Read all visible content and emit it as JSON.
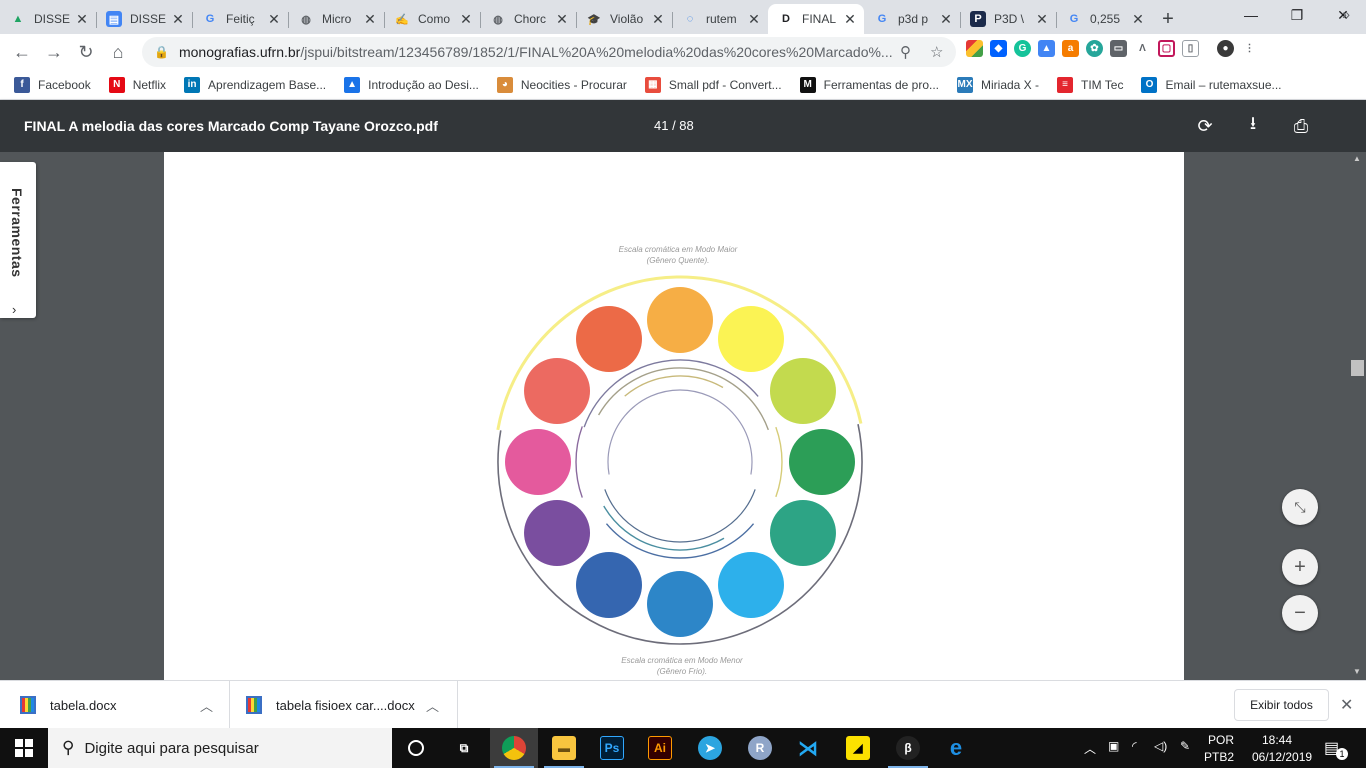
{
  "tabs": [
    {
      "title": "DISSE",
      "icon": "google-drive-icon",
      "color": "#1fa463",
      "active": false
    },
    {
      "title": "DISSE",
      "icon": "google-docs-icon",
      "color": "#4285f4",
      "active": false
    },
    {
      "title": "Feitiç",
      "icon": "google-icon",
      "color": "#4285f4",
      "active": false
    },
    {
      "title": "Micro",
      "icon": "globe-icon",
      "color": "#5f6368",
      "active": false
    },
    {
      "title": "Como",
      "icon": "pen-icon",
      "color": "#c0392b",
      "active": false
    },
    {
      "title": "Chorc",
      "icon": "globe-icon",
      "color": "#5f6368",
      "active": false
    },
    {
      "title": "Violão",
      "icon": "graduation-icon",
      "color": "#e6a817",
      "active": false
    },
    {
      "title": "rutem",
      "icon": "loading-icon",
      "color": "#1a73e8",
      "active": false
    },
    {
      "title": "FINAL",
      "icon": "d-icon",
      "color": "#202124",
      "active": true
    },
    {
      "title": "p3d p",
      "icon": "google-icon",
      "color": "#4285f4",
      "active": false
    },
    {
      "title": "P3D \\",
      "icon": "p-icon",
      "color": "#1b2a4a",
      "active": false
    },
    {
      "title": "0,255",
      "icon": "google-icon",
      "color": "#4285f4",
      "active": false
    }
  ],
  "address": {
    "host": "monografias.ufrn.br",
    "path": "/jspui/bitstream/123456789/1852/1/FINAL%20A%20melodia%20das%20cores%20Marcado%..."
  },
  "bookmarks": [
    {
      "label": "Facebook",
      "icon": "facebook-icon",
      "color": "#3b5998",
      "glyph": "f"
    },
    {
      "label": "Netflix",
      "icon": "netflix-icon",
      "color": "#e50914",
      "glyph": "N"
    },
    {
      "label": "Aprendizagem Base...",
      "icon": "linkedin-icon",
      "color": "#0077b5",
      "glyph": "in"
    },
    {
      "label": "Introdução ao Desi...",
      "icon": "cap-icon",
      "color": "#1a73e8",
      "glyph": "▲"
    },
    {
      "label": "Neocities - Procurar",
      "icon": "cat-icon",
      "color": "#d98c3b",
      "glyph": "◕"
    },
    {
      "label": "Small pdf - Convert...",
      "icon": "smallpdf-icon",
      "color": "#e84c3d",
      "glyph": "▦"
    },
    {
      "label": "Ferramentas de pro...",
      "icon": "m-icon",
      "color": "#111111",
      "glyph": "M"
    },
    {
      "label": "Miriada X -",
      "icon": "mx-icon",
      "color": "#2b7bb9",
      "glyph": "MX"
    },
    {
      "label": "TIM Tec",
      "icon": "tim-icon",
      "color": "#e3262e",
      "glyph": "≡"
    },
    {
      "label": "Email – rutemaxsue...",
      "icon": "outlook-icon",
      "color": "#0072c6",
      "glyph": "O"
    }
  ],
  "pdf": {
    "title": "FINAL A melodia das cores Marcado Comp Tayane Orozco.pdf",
    "pages": "41 / 88",
    "tools_label": "Ferramentas",
    "caption_top": [
      "Escala cromática em Modo Maior",
      "(Gênero Quente)."
    ],
    "caption_bottom": [
      "Escala cromática em Modo Menor",
      "(Gênero Frio)."
    ],
    "wheel_colors": [
      "#f6ae45",
      "#fbf354",
      "#c3da4e",
      "#2c9e57",
      "#2da485",
      "#2db0eb",
      "#2d86c8",
      "#3566b0",
      "#7a4e9f",
      "#e45a9d",
      "#ec6a61",
      "#ec6a47"
    ]
  },
  "downloads": [
    {
      "name": "tabela.docx"
    },
    {
      "name": "tabela fisioex car....docx"
    }
  ],
  "shelf": {
    "show_all": "Exibir todos"
  },
  "taskbar": {
    "search_placeholder": "Digite aqui para pesquisar",
    "lang1": "POR",
    "lang2": "PTB2",
    "time": "18:44",
    "date": "06/12/2019",
    "notif_count": "1"
  }
}
